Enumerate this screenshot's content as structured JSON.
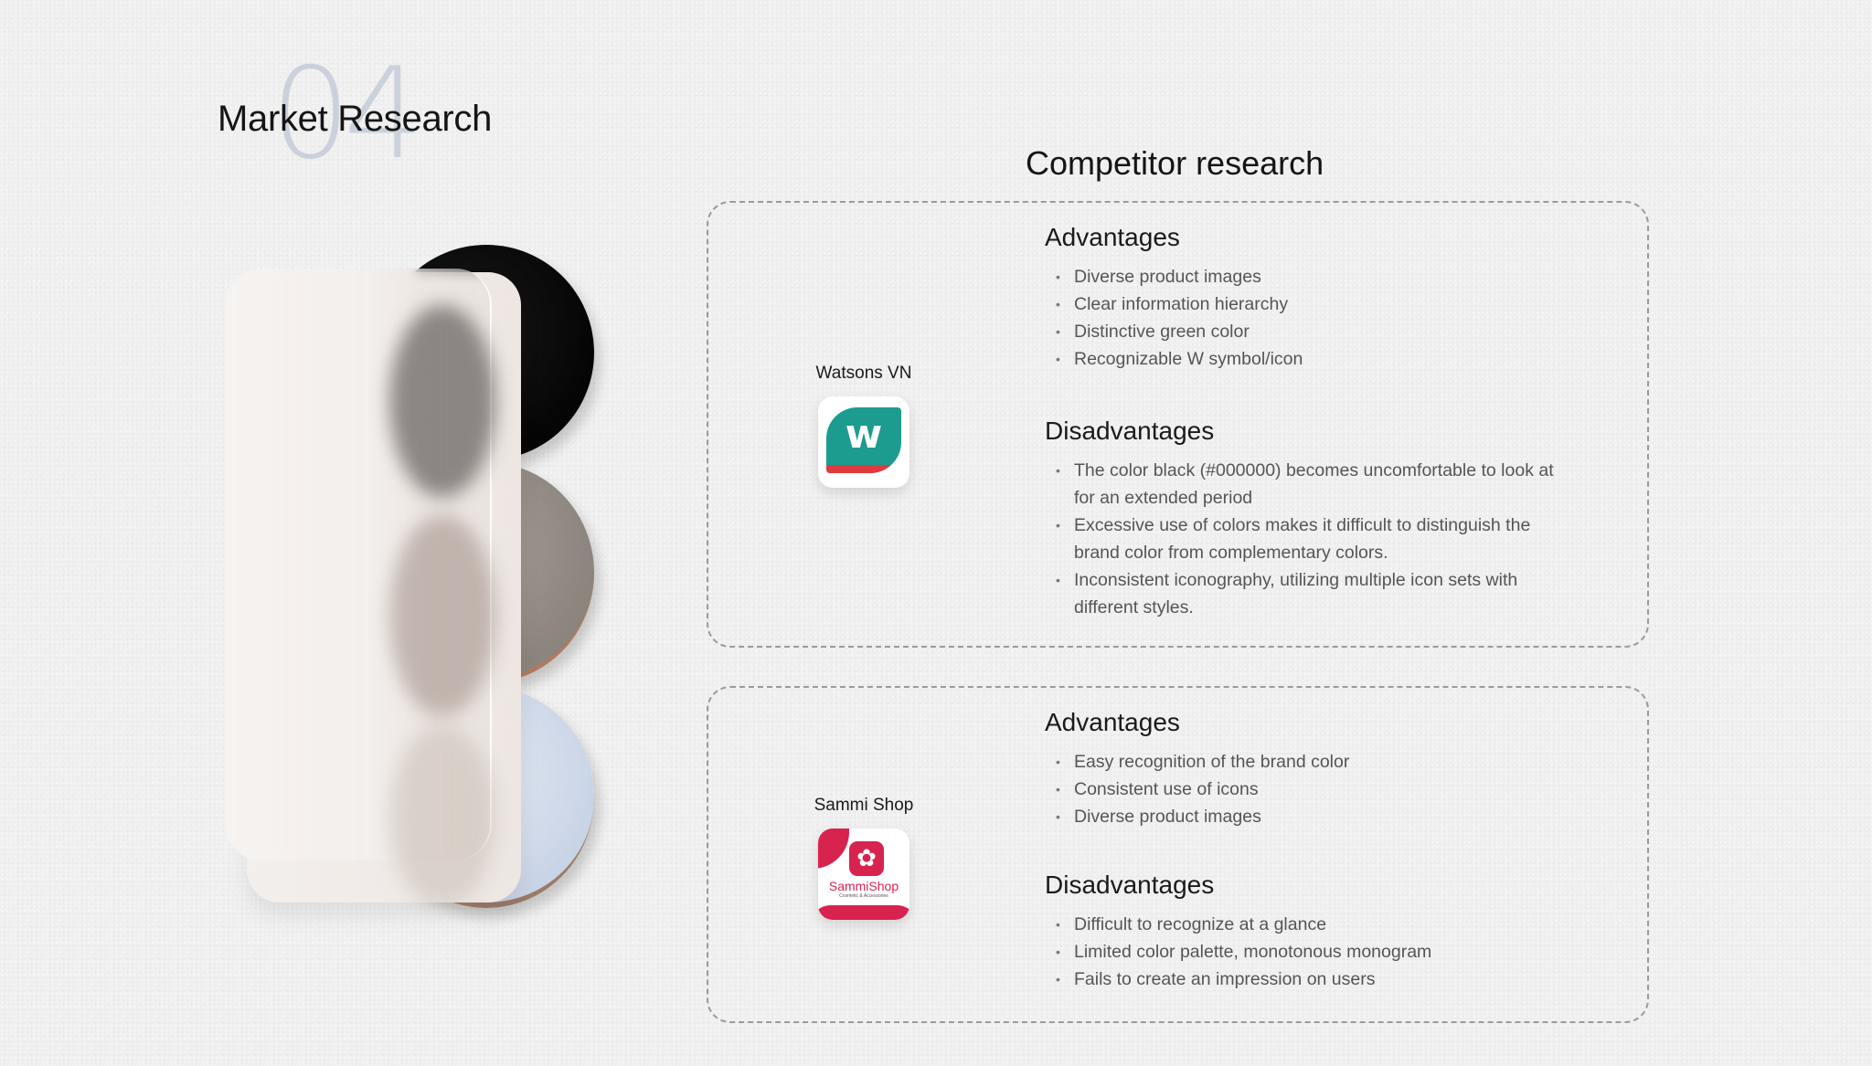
{
  "header": {
    "section_number": "04",
    "title": "Market Research"
  },
  "panel": {
    "title": "Competitor research"
  },
  "competitors": [
    {
      "name": "Watsons VN",
      "logo": {
        "icon": "watsons-w-logo",
        "letter": "w",
        "colors": {
          "primary": "#1c9c8e",
          "accent": "#e03a3e"
        }
      },
      "advantages_heading": "Advantages",
      "advantages": [
        "Diverse product images",
        "Clear information hierarchy",
        "Distinctive green color",
        "Recognizable W symbol/icon"
      ],
      "disadvantages_heading": "Disadvantages",
      "disadvantages": [
        "The color black (#000000) becomes uncomfortable to look at for an extended period",
        "Excessive use of colors makes it difficult to distinguish the brand color from complementary colors.",
        "Inconsistent iconography, utilizing multiple icon sets with different styles."
      ]
    },
    {
      "name": "Sammi Shop",
      "logo": {
        "icon": "sammi-flower-logo",
        "glyph": "✿",
        "wordmark": "SammiShop",
        "tagline": "Cosmetic & Accessories",
        "colors": {
          "primary": "#d9234f"
        }
      },
      "advantages_heading": "Advantages",
      "advantages": [
        "Easy recognition of the brand color",
        "Consistent use of icons",
        "Diverse product images"
      ],
      "disadvantages_heading": "Disadvantages",
      "disadvantages": [
        "Difficult to recognize at a glance",
        "Limited color palette, monotonous monogram",
        "Fails to create an impression on users"
      ]
    }
  ]
}
